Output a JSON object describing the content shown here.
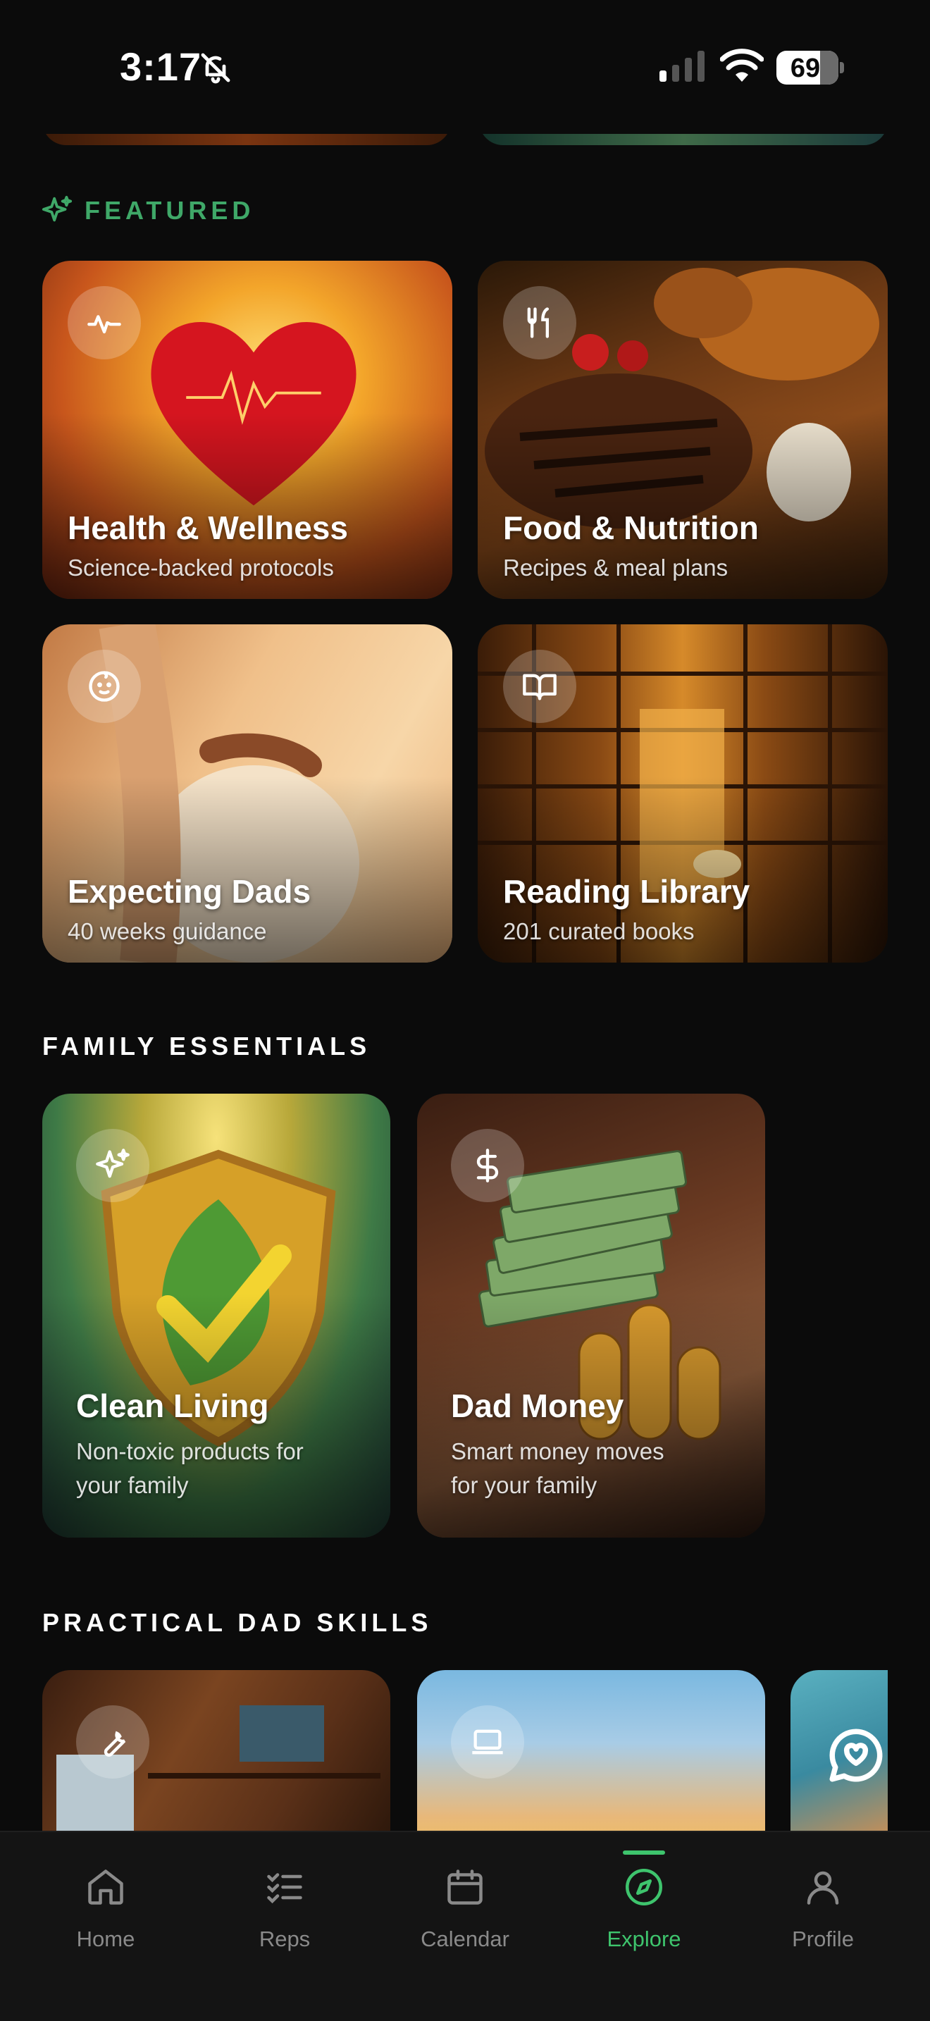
{
  "status_bar": {
    "time": "3:17",
    "battery": "69"
  },
  "featured": {
    "title": "FEATURED",
    "cards": [
      {
        "title": "Health & Wellness",
        "subtitle": "Science-backed protocols",
        "icon": "heartbeat-icon"
      },
      {
        "title": "Food & Nutrition",
        "subtitle": "Recipes & meal plans",
        "icon": "fork-knife-icon"
      },
      {
        "title": "Expecting Dads",
        "subtitle": "40 weeks guidance",
        "icon": "baby-face-icon"
      },
      {
        "title": "Reading Library",
        "subtitle": "201 curated books",
        "icon": "open-book-icon"
      }
    ]
  },
  "family_essentials": {
    "title": "FAMILY ESSENTIALS",
    "cards": [
      {
        "title": "Clean Living",
        "subtitle_line1": "Non-toxic products for",
        "subtitle_line2": "your family",
        "icon": "sparkle-icon"
      },
      {
        "title": "Dad Money",
        "subtitle_line1": "Smart money moves",
        "subtitle_line2": "for your family",
        "icon": "dollar-icon"
      }
    ]
  },
  "practical_skills": {
    "title": "PRACTICAL DAD SKILLS",
    "cards": [
      {
        "icon": "wrench-icon"
      },
      {
        "icon": "laptop-icon"
      }
    ]
  },
  "tabbar": {
    "items": [
      {
        "label": "Home",
        "icon": "home-icon"
      },
      {
        "label": "Reps",
        "icon": "checklist-icon"
      },
      {
        "label": "Calendar",
        "icon": "calendar-icon"
      },
      {
        "label": "Explore",
        "icon": "compass-icon",
        "active": true
      },
      {
        "label": "Profile",
        "icon": "person-icon"
      }
    ]
  },
  "colors": {
    "accent": "#3ec46d",
    "background": "#0b0b0b",
    "section_green": "#3fa868"
  }
}
